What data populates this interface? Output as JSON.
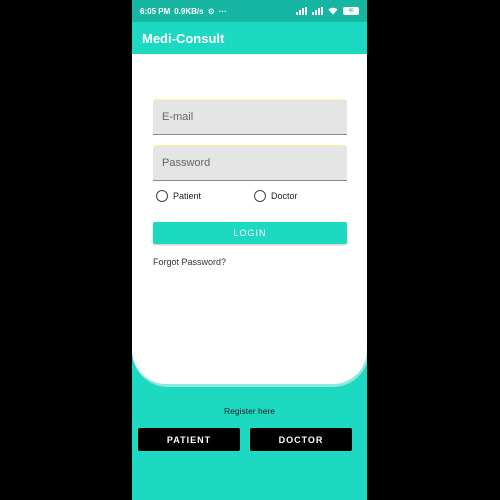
{
  "status_bar": {
    "time": "6:05 PM",
    "speed": "0.9KB/s",
    "dots": "···",
    "battery": "46"
  },
  "app_bar": {
    "title": "Medi-Consult"
  },
  "login_form": {
    "email_placeholder": "E-mail",
    "password_placeholder": "Password",
    "radio_options": [
      "Patient",
      "Doctor"
    ],
    "login_label": "LOGIN",
    "forgot_label": "Forgot Password?"
  },
  "register": {
    "label": "Register here",
    "patient_label": "PATIENT",
    "doctor_label": "DOCTOR"
  },
  "colors": {
    "accent": "#1ed9c1",
    "status_bar": "#17b6a3"
  }
}
